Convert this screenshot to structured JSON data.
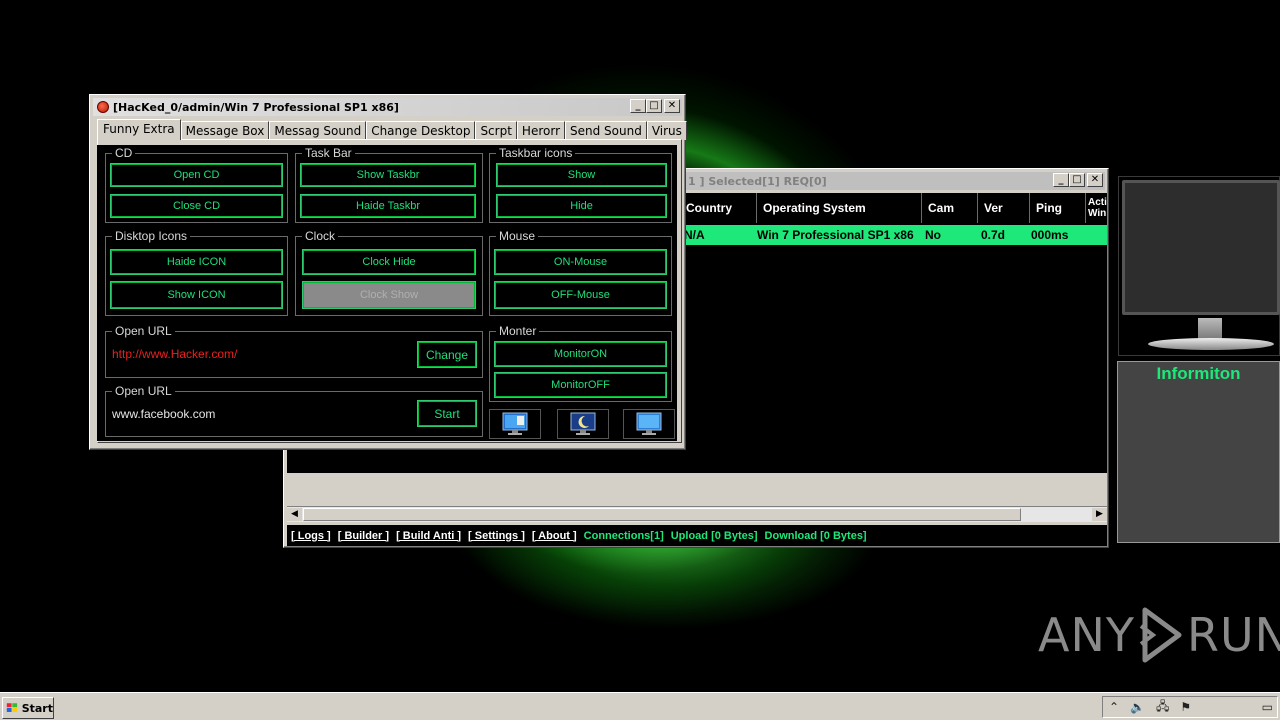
{
  "controller": {
    "title": "[HacKed_0/admin/Win 7 Professional SP1 x86]",
    "tabs": [
      "Funny Extra",
      "Message Box",
      "Messag Sound",
      "Change Desktop",
      "Scrpt",
      "Herorr",
      "Send Sound",
      "Virus"
    ],
    "groups": {
      "cd": {
        "label": "CD",
        "open": "Open CD",
        "close": "Close CD"
      },
      "taskbar": {
        "label": "Task Bar",
        "show": "Show Taskbr",
        "hide": "Haide Taskbr"
      },
      "taskbar_icons": {
        "label": "Taskbar icons",
        "show": "Show",
        "hide": "Hide"
      },
      "desktop_icons": {
        "label": "Disktop  Icons",
        "hide": "Haide ICON",
        "show": "Show ICON"
      },
      "clock": {
        "label": "Clock",
        "hide": "Clock Hide",
        "show": "Clock Show"
      },
      "mouse": {
        "label": "Mouse",
        "on": "ON-Mouse",
        "off": "OFF-Mouse"
      },
      "open_url_1": {
        "label": "Open URL",
        "url": "http://www.Hacker.com/",
        "button": "Change"
      },
      "open_url_2": {
        "label": "Open URL",
        "url": "www.facebook.com",
        "button": "Start"
      },
      "monitor": {
        "label": "Monter",
        "on": "MonitorON",
        "off": "MonitorOFF"
      }
    },
    "icons": [
      "screen-settings-icon",
      "sleep-moon-icon",
      "monitor-screen-icon"
    ]
  },
  "server": {
    "title": "1 ]    Selected[1] REQ[0]",
    "columns": [
      "Country",
      "Operating System",
      "Cam",
      "Ver",
      "Ping",
      "Acti Win"
    ],
    "rows": [
      {
        "country": "N/A",
        "os": "Win 7 Professional SP1 x86",
        "cam": "No",
        "ver": "0.7d",
        "ping": "000ms",
        "active": ""
      }
    ],
    "status": {
      "links": [
        "[ Logs ]",
        "[ Builder ]",
        "[ Build Anti ]",
        "[ Settings ]",
        "[ About ]"
      ],
      "connections": "Connections[1]",
      "upload": "Upload [0 Bytes]",
      "download": "Download [0 Bytes]"
    }
  },
  "side_panel": {
    "title": "Informiton"
  },
  "taskbar": {
    "start_label": "Start"
  },
  "watermark": {
    "text_left": "ANY",
    "text_right": "RUN"
  },
  "colors": {
    "accent_green": "#1ee87a",
    "url_red": "#e82020"
  }
}
